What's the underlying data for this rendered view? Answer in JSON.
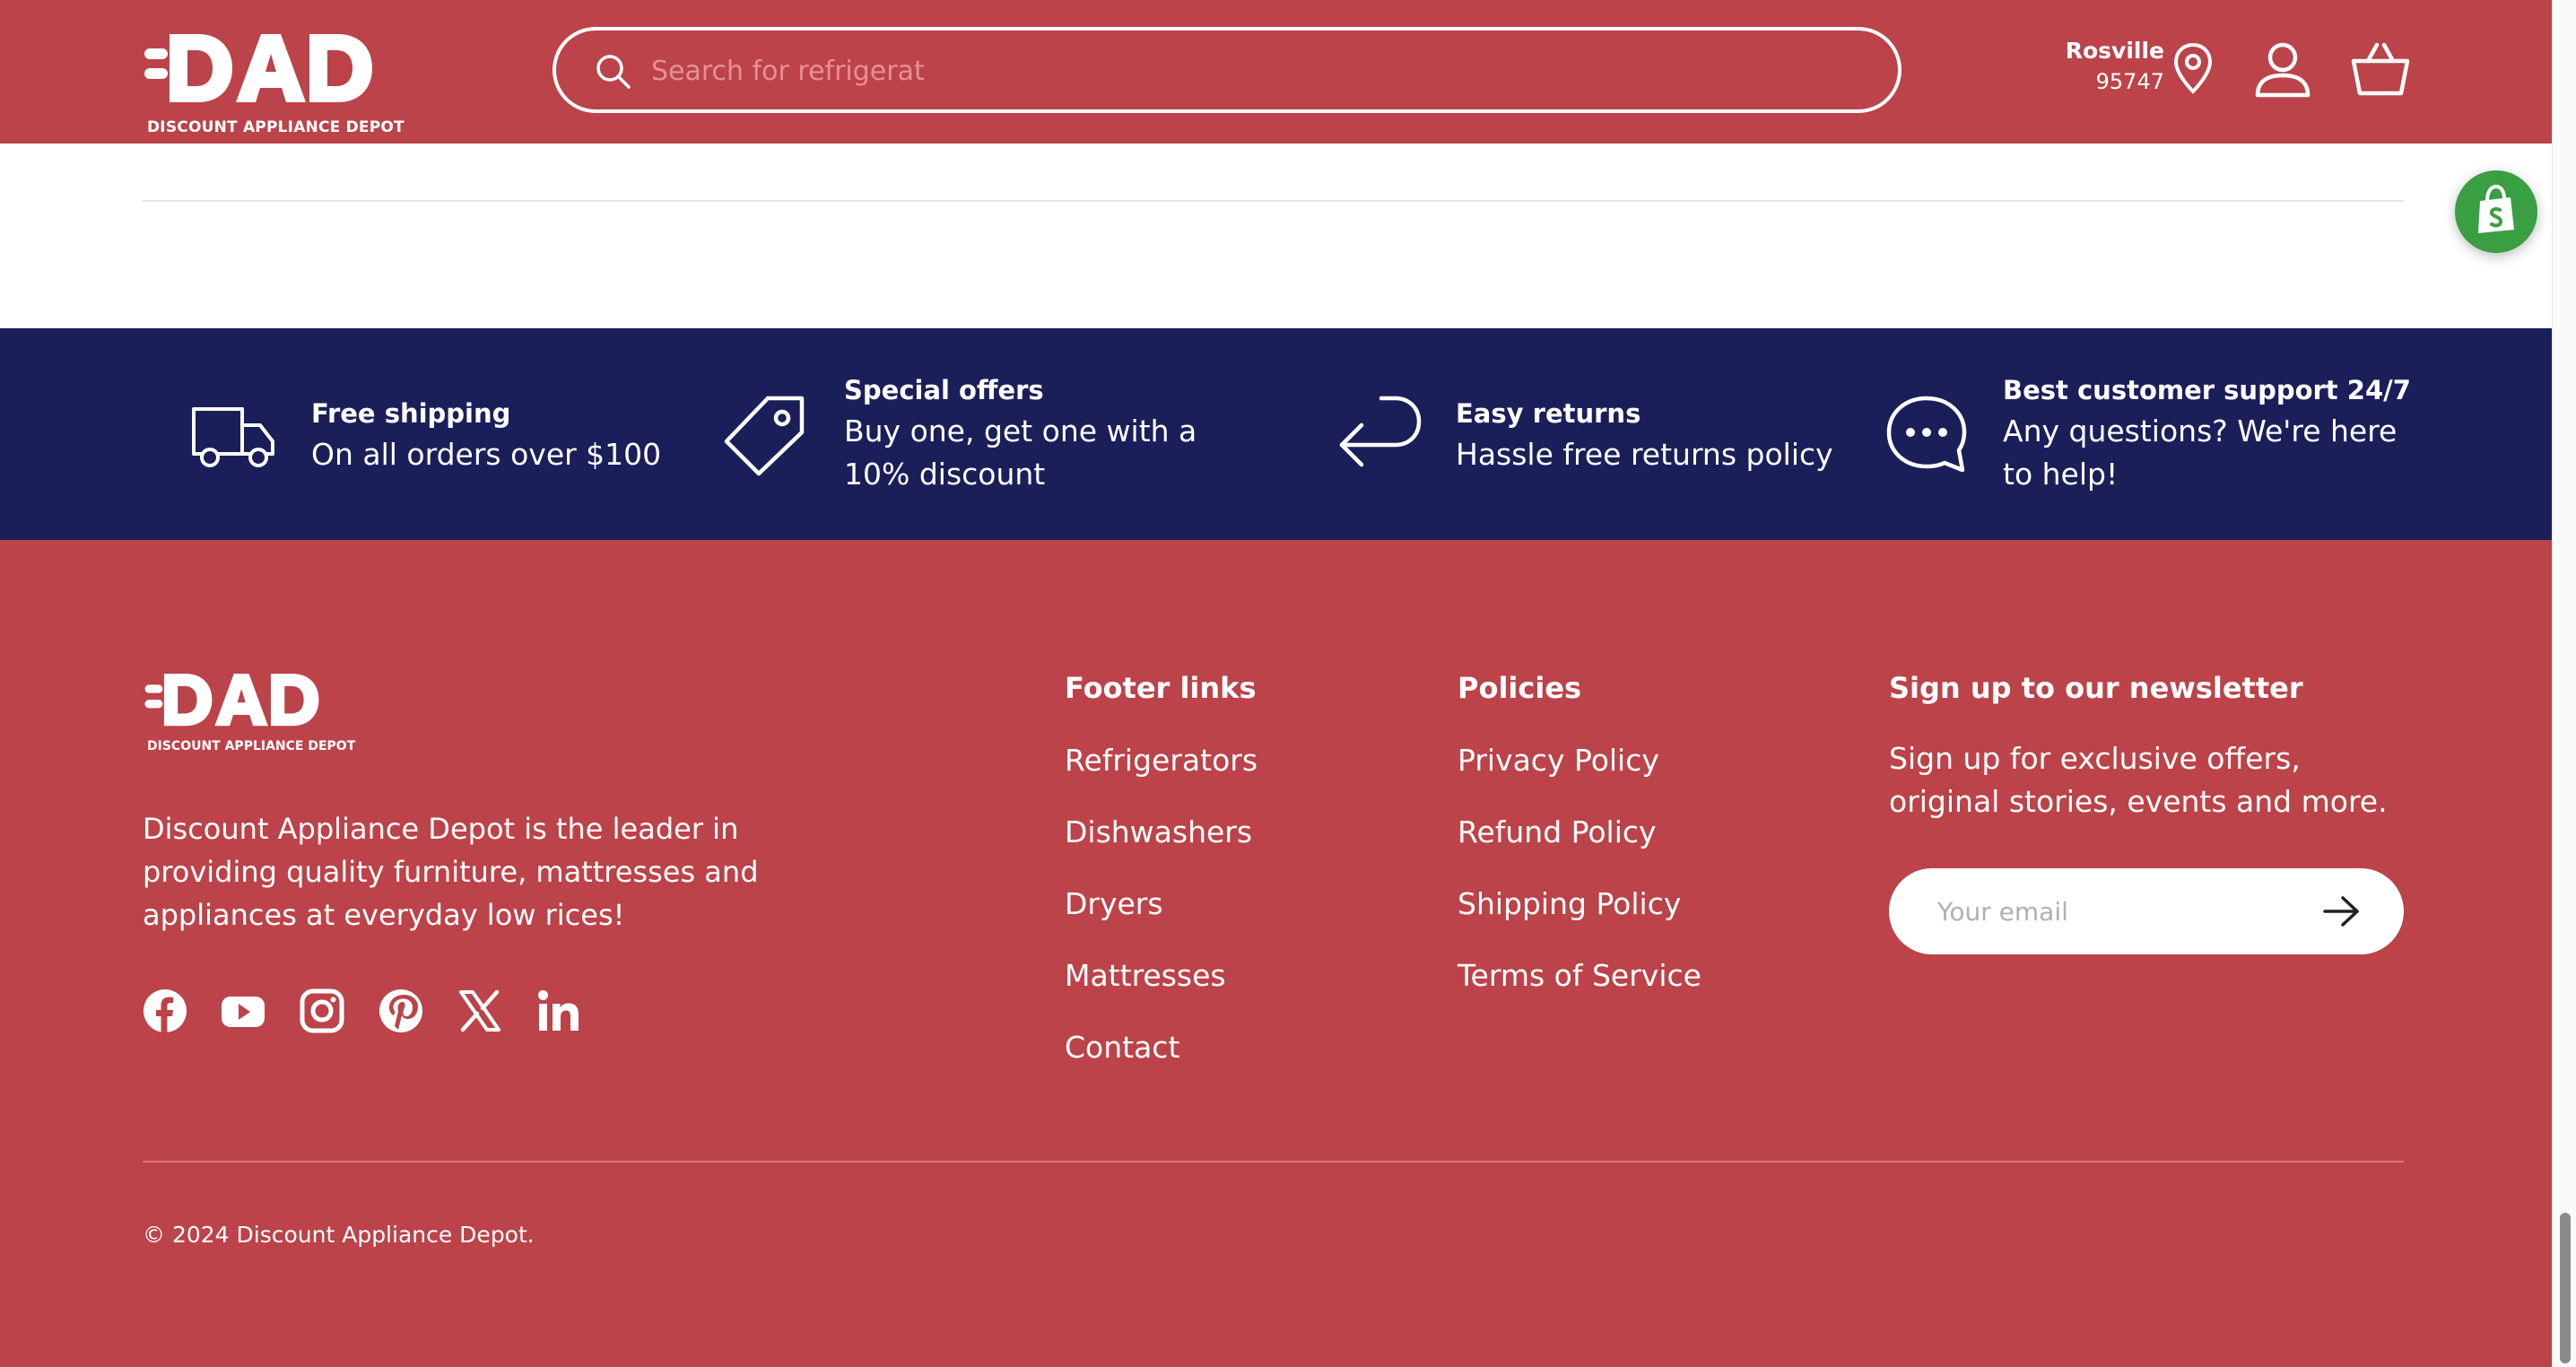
{
  "header": {
    "logo_text": "DAD",
    "logo_subtitle": "DISCOUNT APPLIANCE DEPOT",
    "search_placeholder": "Search for refrigerat",
    "location_city": "Rosville",
    "location_zip": "95747"
  },
  "features": [
    {
      "title": "Free shipping",
      "text": "On all orders over $100",
      "icon": "truck-icon"
    },
    {
      "title": "Special offers",
      "text": "Buy one, get one with a 10% discount",
      "icon": "tag-icon"
    },
    {
      "title": "Easy returns",
      "text": "Hassle free returns policy",
      "icon": "return-arrow-icon"
    },
    {
      "title": "Best customer support 24/7",
      "text": "Any questions? We're here to help!",
      "icon": "chat-bubble-icon"
    }
  ],
  "footer": {
    "logo_text": "DAD",
    "logo_subtitle": "DISCOUNT APPLIANCE DEPOT",
    "about": "Discount Appliance Depot is the leader in providing quality furniture, mattresses and appliances at everyday low rices!",
    "social": [
      "facebook-icon",
      "youtube-icon",
      "instagram-icon",
      "pinterest-icon",
      "x-icon",
      "linkedin-icon"
    ],
    "footer_links_title": "Footer links",
    "footer_links": [
      "Refrigerators",
      "Dishwashers",
      "Dryers",
      "Mattresses",
      "Contact"
    ],
    "policies_title": "Policies",
    "policies": [
      "Privacy Policy",
      "Refund Policy",
      "Shipping Policy",
      "Terms of Service"
    ],
    "newsletter_title": "Sign up to our newsletter",
    "newsletter_text": "Sign up for exclusive offers, original stories, events and more.",
    "email_placeholder": "Your email",
    "copyright": "© 2024 Discount Appliance Depot."
  },
  "colors": {
    "brand_red": "#bc4349",
    "band_navy": "#1b1f59",
    "shopify_green": "#3a9e42"
  }
}
